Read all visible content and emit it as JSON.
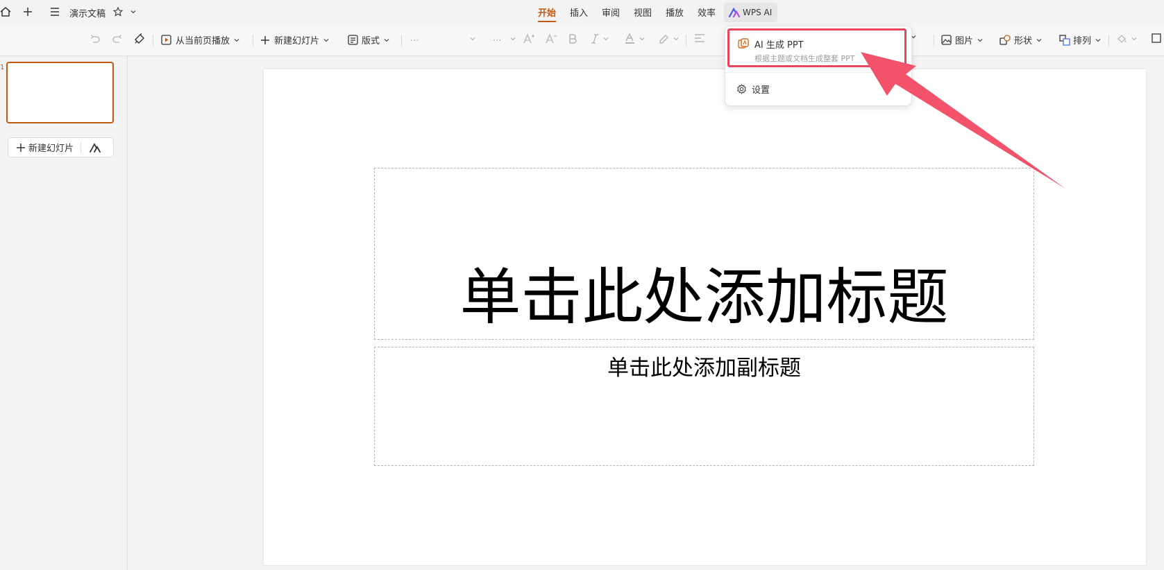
{
  "titlebar": {
    "doc_title": "演示文稿"
  },
  "tabs": [
    {
      "label": "开始",
      "active": true
    },
    {
      "label": "插入"
    },
    {
      "label": "审阅"
    },
    {
      "label": "视图"
    },
    {
      "label": "播放"
    },
    {
      "label": "效率"
    }
  ],
  "wps_ai_tab": {
    "label": "WPS AI"
  },
  "toolbar": {
    "play_label": "从当前页播放",
    "new_slide_label": "新建幻灯片",
    "layout_label": "版式",
    "font_name_placeholder": "...",
    "font_size_placeholder": "...",
    "picture_label": "图片",
    "shape_label": "形状",
    "arrange_label": "排列"
  },
  "left_panel": {
    "slide_number": "1",
    "new_slide_label": "新建幻灯片"
  },
  "slide": {
    "title": "单击此处添加标题",
    "subtitle": "单击此处添加副标题"
  },
  "ai_menu": {
    "items": [
      {
        "label": "AI 生成 PPT",
        "description": "根据主题或文档生成整套 PPT"
      },
      {
        "label": "设置"
      }
    ]
  },
  "colors": {
    "accent": "#c25a14",
    "highlight": "#e8455f",
    "arrow": "#f2536b"
  }
}
